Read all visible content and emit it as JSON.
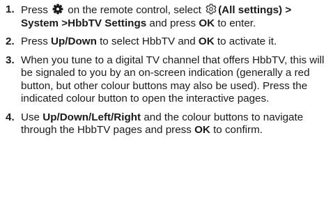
{
  "steps": [
    {
      "number": "1.",
      "parts": [
        {
          "t": "Press "
        },
        {
          "icon": "gear-filled-icon"
        },
        {
          "t": " on the remote control, select "
        },
        {
          "icon": "settings-outline-icon"
        },
        {
          "t": "(All settings) > System >HbbTV Settings",
          "b": true
        },
        {
          "t": " and press "
        },
        {
          "t": "OK",
          "b": true
        },
        {
          "t": " to enter."
        }
      ]
    },
    {
      "number": "2.",
      "parts": [
        {
          "t": "Press "
        },
        {
          "t": "Up/Down",
          "b": true
        },
        {
          "t": " to select HbbTV and "
        },
        {
          "t": "OK",
          "b": true
        },
        {
          "t": " to activate it."
        }
      ]
    },
    {
      "number": "3.",
      "parts": [
        {
          "t": "When you tune to a digital TV channel that offers HbbTV, this will be signaled to you by an on-screen indication (generally a red button, but other colour buttons may also be used). Press the indicated colour button to open the interactive pages."
        }
      ]
    },
    {
      "number": "4.",
      "parts": [
        {
          "t": "Use "
        },
        {
          "t": "Up/Down/Left/Right",
          "b": true
        },
        {
          "t": " and the colour buttons to navigate through the HbbTV pages and press "
        },
        {
          "t": "OK",
          "b": true
        },
        {
          "t": " to confirm."
        }
      ]
    }
  ]
}
